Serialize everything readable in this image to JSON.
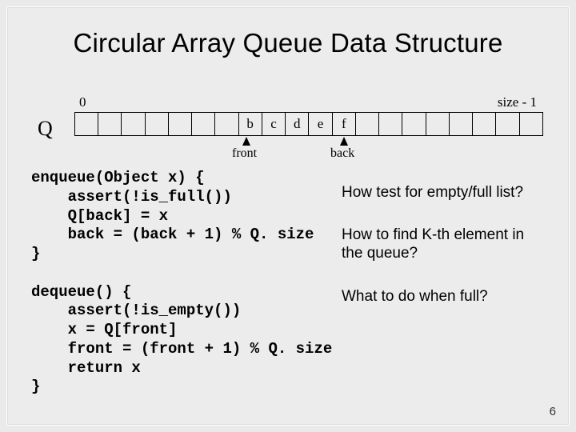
{
  "title": "Circular Array Queue Data Structure",
  "array": {
    "q_label": "Q",
    "index_left": "0",
    "index_right": "size - 1",
    "cells": [
      "",
      "",
      "",
      "",
      "",
      "",
      "",
      "b",
      "c",
      "d",
      "e",
      "f",
      "",
      "",
      "",
      "",
      "",
      "",
      "",
      ""
    ],
    "front_label": "front",
    "back_label": "back"
  },
  "code_enqueue": "enqueue(Object x) {\n    assert(!is_full())\n    Q[back] = x\n    back = (back + 1) % Q. size\n}",
  "code_dequeue": "dequeue() {\n    assert(!is_empty())\n    x = Q[front]\n    front = (front + 1) % Q. size\n    return x\n}",
  "questions": {
    "q1": "How test for empty/full list?",
    "q2": "How to find K-th element in the queue?",
    "q3": "What to do when full?"
  },
  "page_number": "6"
}
